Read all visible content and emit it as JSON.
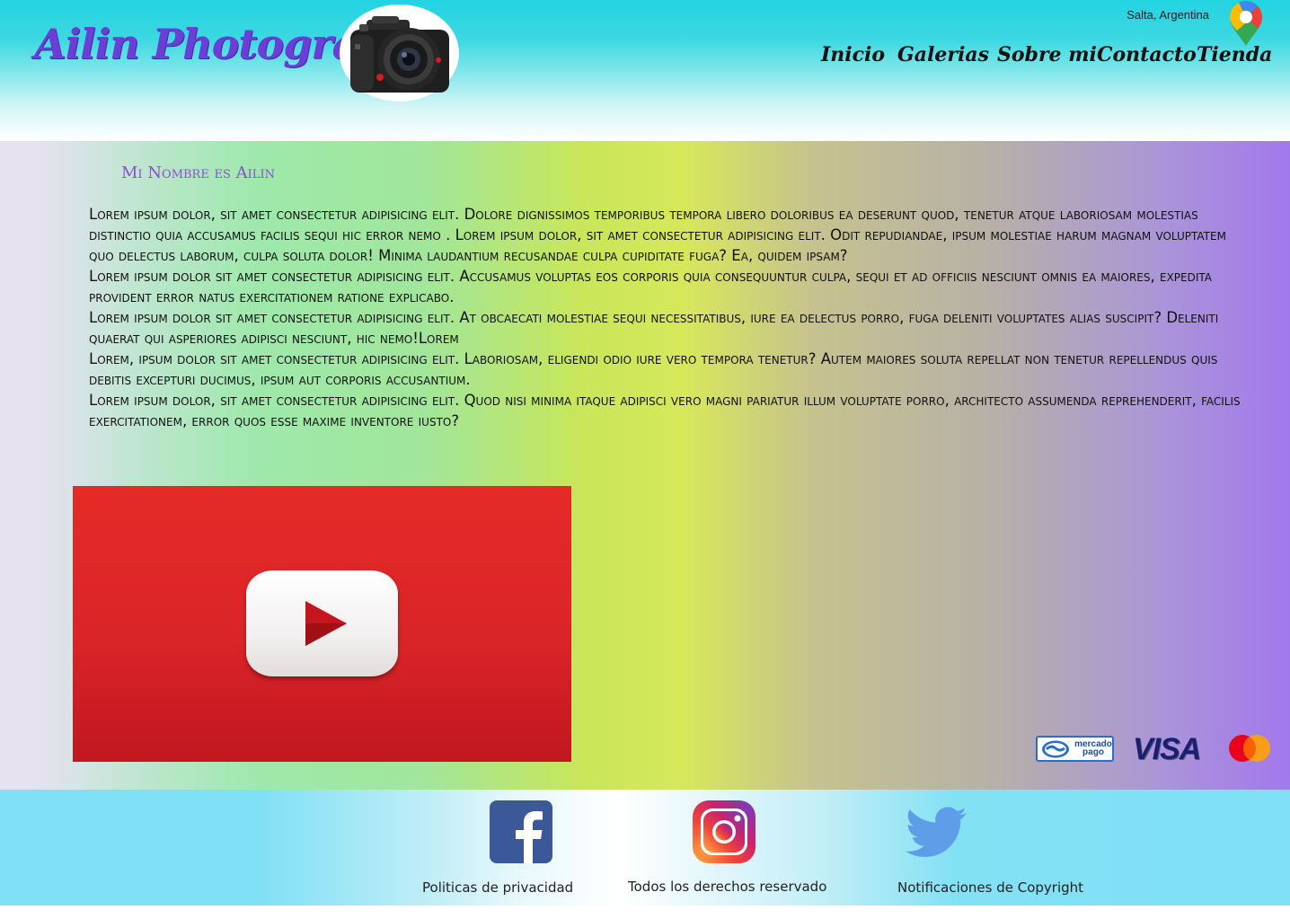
{
  "header": {
    "site_title": "Ailin Photografh",
    "location": "Salta, Argentina",
    "nav": [
      "Inicio",
      "Galerias",
      "Sobre mi",
      "Contacto",
      "Tienda"
    ]
  },
  "main": {
    "heading": "Mi Nombre es Ailin",
    "paragraphs": [
      "Lorem ipsum dolor, sit amet consectetur adipisicing elit. Dolore dignissimos temporibus tempora libero doloribus ea deserunt quod, tenetur atque laboriosam molestias distinctio quia accusamus facilis sequi hic error nemo . Lorem ipsum dolor, sit amet consectetur adipisicing elit. Odit repudiandae, ipsum molestiae harum magnam voluptatem quo delectus laborum, culpa soluta dolor! Minima laudantium recusandae culpa cupiditate fuga? Ea, quidem ipsam?",
      "Lorem ipsum dolor sit amet consectetur adipisicing elit. Accusamus voluptas eos corporis quia consequuntur culpa, sequi et ad officiis nesciunt omnis ea maiores, expedita provident error natus exercitationem ratione explicabo.",
      "Lorem ipsum dolor sit amet consectetur adipisicing elit. At obcaecati molestiae sequi necessitatibus, iure ea delectus porro, fuga deleniti voluptates alias suscipit? Deleniti quaerat qui asperiores adipisci nesciunt, hic nemo!Lorem",
      "Lorem, ipsum dolor sit amet consectetur adipisicing elit. Laboriosam, eligendi odio iure vero tempora tenetur? Autem maiores soluta repellat non tenetur repellendus quis debitis excepturi ducimus, ipsum aut corporis accusantium.",
      "Lorem ipsum dolor, sit amet consectetur adipisicing elit. Quod nisi minima itaque adipisci vero magni pariatur illum voluptate porro, architecto assumenda reprehenderit, facilis exercitationem, error quos esse maxime inventore iusto?"
    ]
  },
  "payments": {
    "mercadopago_text_1": "mercado",
    "mercadopago_text_2": "pago",
    "visa": "VISA"
  },
  "footer": {
    "links": [
      "Politicas de privacidad",
      "Todos los derechos reservado",
      "Notificaciones de Copyright"
    ],
    "icons": [
      "facebook-icon",
      "instagram-icon",
      "twitter-icon"
    ]
  },
  "colors": {
    "title": "#6a3fd6",
    "heading": "#8a4fd6",
    "youtube_red": "#e02b27",
    "facebook_blue": "#3b5998",
    "twitter_blue": "#5e9ee8"
  }
}
